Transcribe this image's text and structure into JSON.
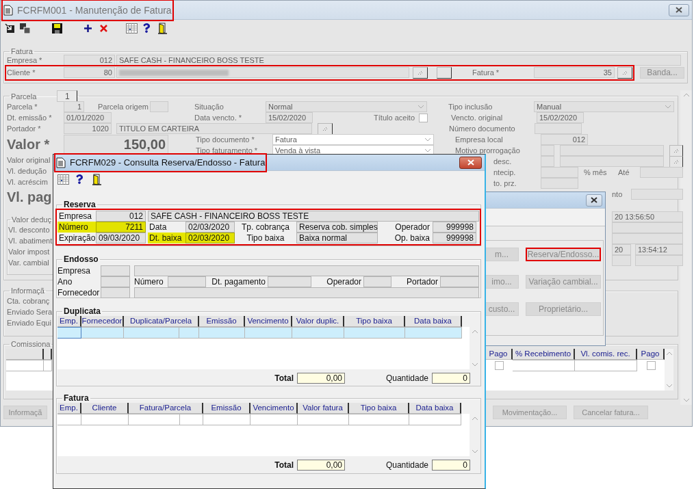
{
  "main_window": {
    "title": "FCRFM001 - Manutenção de Fatura",
    "title_outlined": true,
    "fatura": {
      "legend": "Fatura",
      "empresa": {
        "label": "Empresa *",
        "code": "012",
        "name": "SAFE CASH - FINANCEIRO BOSS TESTE"
      },
      "cliente": {
        "label": "Cliente *",
        "code": "80",
        "outlined": true
      },
      "fatura": {
        "label": "Fatura *",
        "value": "35"
      },
      "banda_button": "Banda..."
    },
    "parcela": {
      "legend": "Parcela",
      "tab": "1",
      "parcela": {
        "label": "Parcela *",
        "value": "1"
      },
      "parcela_origem": {
        "label": "Parcela origem"
      },
      "situacao": {
        "label": "Situação",
        "value": "Normal"
      },
      "tipo_inclusao": {
        "label": "Tipo inclusão",
        "value": "Manual"
      },
      "dt_emissao": {
        "label": "Dt. emissão *",
        "value": "01/01/2020"
      },
      "data_vencto": {
        "label": "Data vencto. *",
        "value": "15/02/2020"
      },
      "titulo_aceito": {
        "label": "Título aceito",
        "checked": false
      },
      "vencto_original": {
        "label": "Vencto. original",
        "value": "15/02/2020"
      },
      "portador": {
        "label": "Portador *",
        "code": "1020",
        "name": "TITULO EM CARTEIRA"
      },
      "numero_documento": {
        "label": "Número documento"
      },
      "valor": {
        "label": "Valor *",
        "value": "150,00"
      },
      "tipo_documento": {
        "label": "Tipo documento *",
        "value": "Fatura"
      },
      "tipo_faturamento": {
        "label": "Tipo faturamento *",
        "value": "Venda à vista"
      },
      "empresa_local": {
        "label": "Empresa local",
        "value": "012"
      },
      "motivo_prorrogacao": {
        "label": "Motivo prorrogação"
      },
      "left_labels": [
        "Valor original",
        "Vl. dedução",
        "Vl. acréscim"
      ],
      "vl_pag": "Vl. pag",
      "right_labels": [
        "desc.",
        "ntecip.",
        "to. prz."
      ],
      "pct_mes": "% mês",
      "ate": "Até",
      "nto_label": "nto",
      "emissao_time": "20 13:56:50",
      "alteracao_date": "20",
      "alteracao_time": "13:54:12",
      "valor_deducao": {
        "legend": "Valor deduç",
        "labels": [
          "Vl. desconto",
          "Vl. abatiment",
          "Valor impost",
          "Var. cambial"
        ]
      }
    },
    "informacao": {
      "legend": "Informaçã",
      "labels": [
        "Cta. cobranç",
        "Enviado Sera",
        "Enviado Equi"
      ]
    },
    "comissionamento": {
      "legend": "Comissiona",
      "columns": [
        "Pago",
        "% Recebimento",
        "Vl. comis. rec.",
        "Pago"
      ],
      "pago_checked": false,
      "pago_rec_checked": false
    },
    "buttons": [
      "Informaçã",
      "Movimentação...",
      "Cancelar fatura..."
    ]
  },
  "reserva_dialog": {
    "title": "FCRFM029 - Consulta Reserva/Endosso - Fatura",
    "title_outlined": true,
    "reserva": {
      "legend": "Reserva",
      "outlined": true,
      "empresa": {
        "label": "Empresa",
        "code": "012",
        "name": "SAFE CASH - FINANCEIRO BOSS TESTE"
      },
      "numero": {
        "label": "Número",
        "value": "7211",
        "marked": true
      },
      "data": {
        "label": "Data",
        "value": "02/03/2020",
        "marked": false
      },
      "tp_cobranca": {
        "label": "Tp. cobrança",
        "value": "Reserva cob. simples"
      },
      "operador": {
        "label": "Operador",
        "value": "999998"
      },
      "expiracao": {
        "label": "Expiração",
        "value": "09/03/2020",
        "marked": false
      },
      "dt_baixa": {
        "label": "Dt. baixa",
        "value": "02/03/2020",
        "marked": true
      },
      "tipo_baixa": {
        "label": "Tipo baixa",
        "value": "Baixa normal"
      },
      "op_baixa": {
        "label": "Op. baixa",
        "value": "999998"
      }
    },
    "endosso": {
      "legend": "Endosso",
      "empresa": "Empresa",
      "ano": "Ano",
      "fornecedor": "Fornecedor",
      "numero": "Número",
      "dt_pagamento": "Dt. pagamento",
      "operador": "Operador",
      "portador": "Portador"
    },
    "duplicata": {
      "legend": "Duplicata",
      "columns": [
        "Emp.",
        "Fornecedor",
        "Duplicata/Parcela",
        "Emissão",
        "Vencimento",
        "Valor duplic.",
        "Tipo baixa",
        "Data baixa"
      ],
      "row_selected": true,
      "total_label": "Total",
      "total": "0,00",
      "quantidade_label": "Quantidade",
      "quantidade": "0"
    },
    "fatura": {
      "legend": "Fatura",
      "columns": [
        "Emp.",
        "Cliente",
        "Fatura/Parcela",
        "Emissão",
        "Vencimento",
        "Valor fatura",
        "Tipo baixa",
        "Data baixa"
      ],
      "row_selected": false,
      "total_label": "Total",
      "total": "0,00",
      "quantidade_label": "Quantidade",
      "quantidade": "0"
    }
  },
  "options_dialog": {
    "buttons": [
      {
        "label": "m...",
        "outlined": false
      },
      {
        "label": "Reserva/Endosso...",
        "outlined": true
      },
      {
        "label": "imo...",
        "outlined": false
      },
      {
        "label": "Variação cambial...",
        "outlined": false
      },
      {
        "label": "custo...",
        "outlined": false
      },
      {
        "label": "Proprietário...",
        "outlined": false
      }
    ]
  }
}
